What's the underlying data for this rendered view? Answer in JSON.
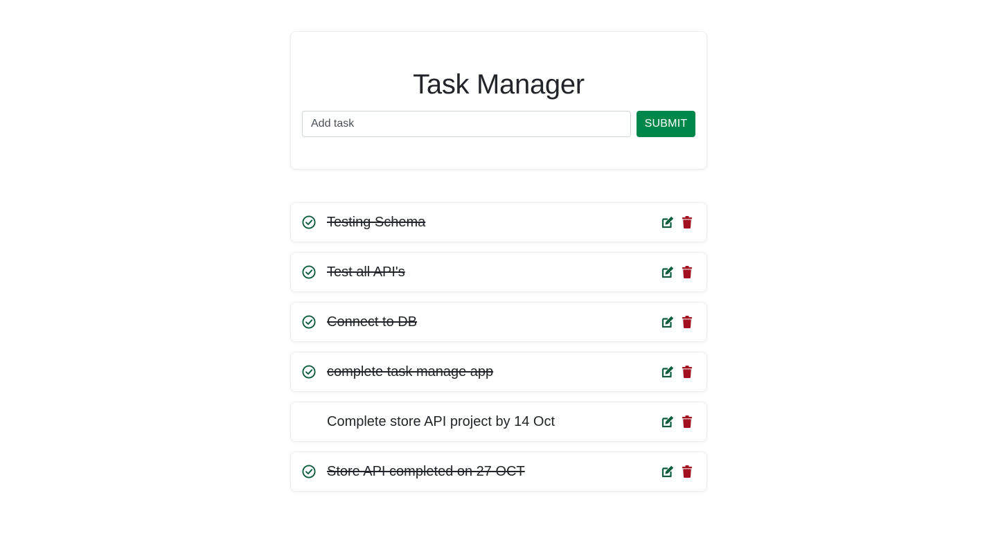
{
  "header": {
    "title": "Task Manager",
    "input_placeholder": "Add task",
    "input_value": "",
    "submit_label": "SUBMIT"
  },
  "colors": {
    "accent_green": "#00884b",
    "icon_green": "#0b5d3b",
    "delete_red": "#a3101f"
  },
  "icons": {
    "completed": "check-circle-icon",
    "edit": "edit-icon",
    "delete": "trash-icon"
  },
  "tasks": [
    {
      "text": "Testing Schema",
      "completed": true
    },
    {
      "text": "Test all API's",
      "completed": true
    },
    {
      "text": "Connect to DB",
      "completed": true
    },
    {
      "text": "complete task manage app",
      "completed": true
    },
    {
      "text": "Complete store API project by 14 Oct",
      "completed": false
    },
    {
      "text": "Store API completed on 27 OCT",
      "completed": true
    }
  ]
}
